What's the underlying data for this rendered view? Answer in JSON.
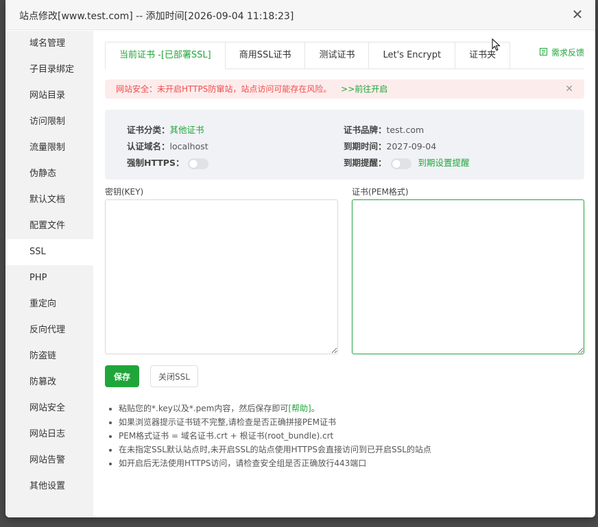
{
  "dialog": {
    "title": "站点修改[www.test.com] -- 添加时间[2026-09-04 11:18:23]",
    "close_glyph": "✕"
  },
  "sidebar": {
    "items": [
      {
        "label": "域名管理"
      },
      {
        "label": "子目录绑定"
      },
      {
        "label": "网站目录"
      },
      {
        "label": "访问限制"
      },
      {
        "label": "流量限制"
      },
      {
        "label": "伪静态"
      },
      {
        "label": "默认文档"
      },
      {
        "label": "配置文件"
      },
      {
        "label": "SSL",
        "active": true
      },
      {
        "label": "PHP"
      },
      {
        "label": "重定向"
      },
      {
        "label": "反向代理"
      },
      {
        "label": "防盗链"
      },
      {
        "label": "防篡改"
      },
      {
        "label": "网站安全"
      },
      {
        "label": "网站日志"
      },
      {
        "label": "网站告警"
      },
      {
        "label": "其他设置"
      }
    ]
  },
  "tabs": [
    {
      "label": "当前证书 -[已部署SSL]",
      "active": true
    },
    {
      "label": "商用SSL证书"
    },
    {
      "label": "测试证书"
    },
    {
      "label": "Let's Encrypt"
    },
    {
      "label": "证书夹"
    }
  ],
  "feedback": {
    "label": "需求反馈",
    "icon": "feedback-icon"
  },
  "alert": {
    "message": "网站安全：未开启HTTPS防窜站，站点访问可能存在风险。",
    "link": ">>前往开启",
    "close_glyph": "✕"
  },
  "cert": {
    "category_key": "证书分类：",
    "category_value": "其他证书",
    "domain_key": "认证域名：",
    "domain_value": "localhost",
    "force_https_key": "强制HTTPS：",
    "brand_key": "证书品牌：",
    "brand_value": "test.com",
    "expire_key": "到期时间：",
    "expire_value": "2027-09-04",
    "reminder_key": "到期提醒：",
    "reminder_link": "到期设置提醒"
  },
  "key_field": {
    "label": "密钥(KEY)",
    "value": ""
  },
  "pem_field": {
    "label": "证书(PEM格式)",
    "value": ""
  },
  "buttons": {
    "save": "保存",
    "close_ssl": "关闭SSL"
  },
  "tips": {
    "tip1_prefix": "粘贴您的*.key以及*.pem内容，然后保存即可",
    "tip1_help": "[帮助]",
    "tip1_suffix": "。",
    "tip2": "如果浏览器提示证书链不完整,请检查是否正确拼接PEM证书",
    "tip3": "PEM格式证书 = 域名证书.crt + 根证书(root_bundle).crt",
    "tip4": "在未指定SSL默认站点时,未开启SSL的站点使用HTTPS会直接访问到已开启SSL的站点",
    "tip5": "如开启后无法使用HTTPS访问，请检查安全组是否正确放行443端口"
  },
  "colors": {
    "accent": "#20a53a",
    "danger": "#ef4d4d",
    "alert_bg": "#fdecec",
    "panel_bg": "#f0f2f5"
  }
}
